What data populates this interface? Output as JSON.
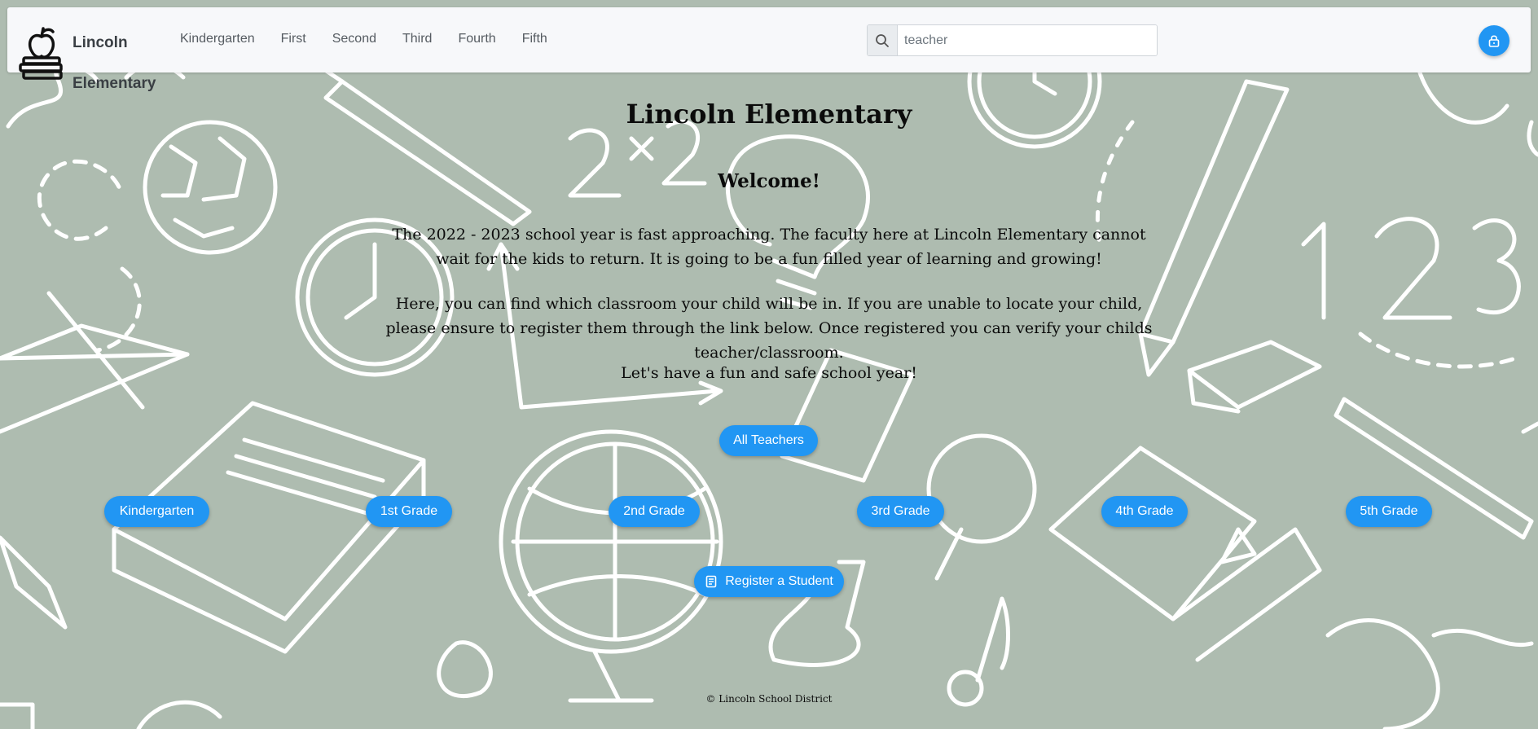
{
  "navbar": {
    "brand_line1": "Lincoln",
    "brand_line2": "Elementary",
    "links": [
      "Kindergarten",
      "First",
      "Second",
      "Third",
      "Fourth",
      "Fifth"
    ],
    "search": {
      "value": "teacher"
    }
  },
  "main": {
    "title": "Lincoln Elementary",
    "welcome": "Welcome!",
    "paragraph1": "The 2022 - 2023 school year is fast approaching. The faculty here at Lincoln Elementary cannot wait for the kids to return. It is going to be a fun filled year of learning and growing!",
    "paragraph2": "Here, you can find which classroom your child will be in. If you are unable to locate your child, please ensure to register them through the link below. Once registered you can verify your childs teacher/classroom.",
    "paragraph3": "Let's have a fun and safe school year!",
    "all_teachers": "All Teachers",
    "grades": [
      "Kindergarten",
      "1st Grade",
      "2nd Grade",
      "3rd Grade",
      "4th Grade",
      "5th Grade"
    ],
    "register": "Register a Student"
  },
  "footer": "© Lincoln School District",
  "colors": {
    "accent": "#2196f3",
    "background": "#aebcb0",
    "doodle": "#ffffff"
  },
  "icons": [
    "books-apple-logo",
    "search-icon",
    "lock-icon",
    "document-icon"
  ]
}
